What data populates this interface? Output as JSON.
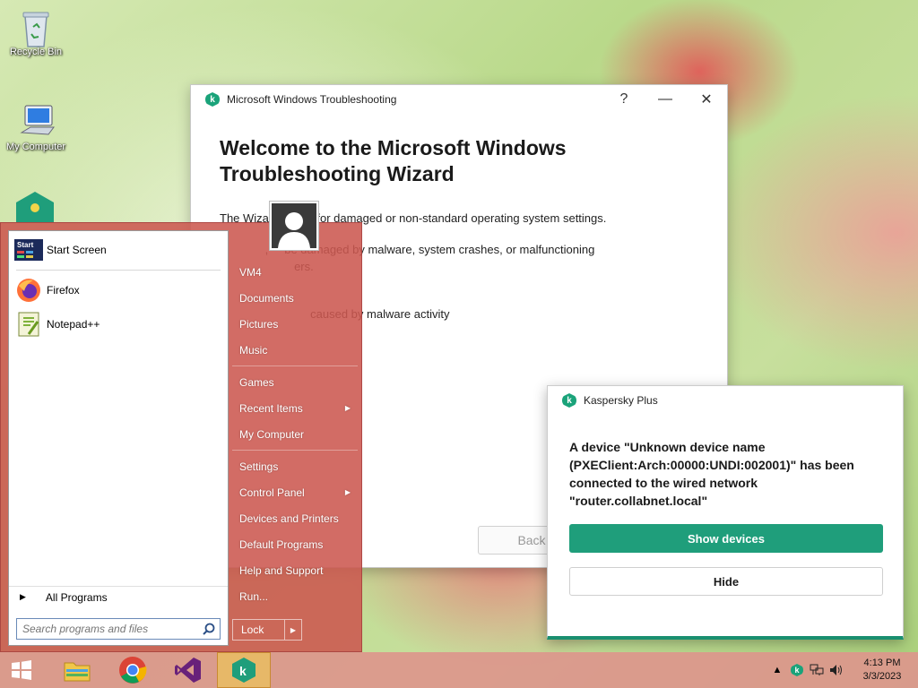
{
  "desktop": {
    "icons": [
      {
        "label": "Recycle Bin",
        "icon": "recycle-bin-icon"
      },
      {
        "label": "My Computer",
        "icon": "computer-icon"
      }
    ]
  },
  "wizard": {
    "title": "Microsoft Windows Troubleshooting",
    "help": "?",
    "minimize": "—",
    "close": "✕",
    "heading": "Welcome to the Microsoft Windows Troubleshooting Wizard",
    "para1": "The Wiza          es for damaged or non-standard operating system settings.",
    "para2a": "              ,     be damaged by malware, system crashes, or malfunctioning",
    "para2b": "                       ers.",
    "para3": "                            caused by malware activity",
    "back": "Back"
  },
  "startmenu": {
    "pinned": [
      {
        "label": "Start Screen",
        "icon": "start-screen-icon"
      },
      {
        "label": "Firefox",
        "icon": "firefox-icon"
      },
      {
        "label": "Notepad++",
        "icon": "notepad-plus-plus-icon"
      }
    ],
    "all_programs": "All Programs",
    "search_placeholder": "Search programs and files",
    "right_links": [
      {
        "label": "VM4",
        "arrow": false
      },
      {
        "label": "Documents",
        "arrow": false
      },
      {
        "label": "Pictures",
        "arrow": false
      },
      {
        "label": "Music",
        "arrow": false
      },
      {
        "label": "Games",
        "arrow": false
      },
      {
        "label": "Recent Items",
        "arrow": true
      },
      {
        "label": "My Computer",
        "arrow": false
      },
      {
        "label": "Settings",
        "arrow": false
      },
      {
        "label": "Control Panel",
        "arrow": true
      },
      {
        "label": "Devices and Printers",
        "arrow": false
      },
      {
        "label": "Default Programs",
        "arrow": false
      },
      {
        "label": "Help and Support",
        "arrow": false
      },
      {
        "label": "Run...",
        "arrow": false
      }
    ],
    "lock": "Lock"
  },
  "kaspersky": {
    "title": "Kaspersky Plus",
    "message": "A device \"Unknown device name (PXEClient:Arch:00000:UNDI:002001)\" has been connected to the wired network \"router.collabnet.local\"",
    "show_devices": "Show devices",
    "hide": "Hide"
  },
  "taskbar": {
    "apps": [
      "windows-start-icon",
      "file-explorer-icon",
      "chrome-icon",
      "visual-studio-icon",
      "kaspersky-icon"
    ],
    "time": "4:13 PM",
    "date": "3/3/2023"
  },
  "colors": {
    "kaspersky_green": "#1f9e7b",
    "startmenu_bg": "#cc5850",
    "taskbar_active": "#e7b868"
  }
}
